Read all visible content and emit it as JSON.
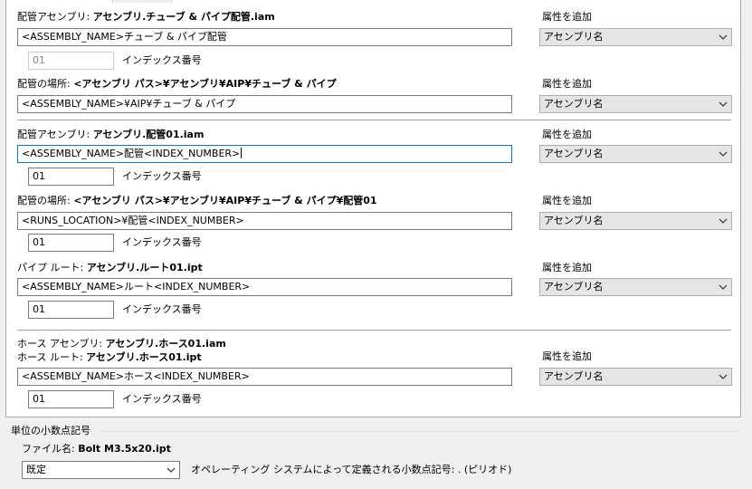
{
  "sections": [
    {
      "caption_prefix": "配管アセンブリ: ",
      "caption_value": "アセンブリ.チューブ & パイプ配管.iam",
      "textbox": "<ASSEMBLY_NAME>チューブ & パイプ配管",
      "attr_label": "属性を追加",
      "attr_value": "アセンブリ名",
      "index_value": "01",
      "index_label": "インデックス番号"
    },
    {
      "caption_prefix": "配管の場所: ",
      "caption_value": "<アセンブリ パス>¥アセンブリ¥AIP¥チューブ & パイプ",
      "textbox": "<ASSEMBLY_NAME>¥AIP¥チューブ & パイプ",
      "attr_label": "属性を追加",
      "attr_value": "アセンブリ名"
    },
    {
      "caption_prefix": "配管アセンブリ: ",
      "caption_value": "アセンブリ.配管01.iam",
      "textbox": "<ASSEMBLY_NAME>配管<INDEX_NUMBER>",
      "attr_label": "属性を追加",
      "attr_value": "アセンブリ名",
      "index_value": "01",
      "index_label": "インデックス番号"
    },
    {
      "caption_prefix": "配管の場所: ",
      "caption_value": "<アセンブリ パス>¥アセンブリ¥AIP¥チューブ & パイプ¥配管01",
      "textbox": "<RUNS_LOCATION>¥配管<INDEX_NUMBER>",
      "attr_label": "属性を追加",
      "attr_value": "アセンブリ名",
      "index_value": "01",
      "index_label": "インデックス番号"
    },
    {
      "caption_prefix": "パイプ ルート: ",
      "caption_value": "アセンブリ.ルート01.ipt",
      "textbox": "<ASSEMBLY_NAME>ルート<INDEX_NUMBER>",
      "attr_label": "属性を追加",
      "attr_value": "アセンブリ名",
      "index_value": "01",
      "index_label": "インデックス番号"
    },
    {
      "caption_prefix": "ホース アセンブリ: ",
      "caption_value": "アセンブリ.ホース01.iam",
      "caption2_prefix": "ホース ルート: ",
      "caption2_value": "アセンブリ.ホース01.ipt",
      "textbox": "<ASSEMBLY_NAME>ホース<INDEX_NUMBER>",
      "attr_label": "属性を追加",
      "attr_value": "アセンブリ名",
      "index_value": "01",
      "index_label": "インデックス番号"
    }
  ],
  "decimal": {
    "group_title": "単位の小数点記号",
    "file_prefix": "ファイル名: ",
    "file_value": "Bolt M3.5x20.ipt",
    "select_value": "既定",
    "description": "オペレーティング システムによって定義される小数点記号: . (ピリオド)"
  }
}
